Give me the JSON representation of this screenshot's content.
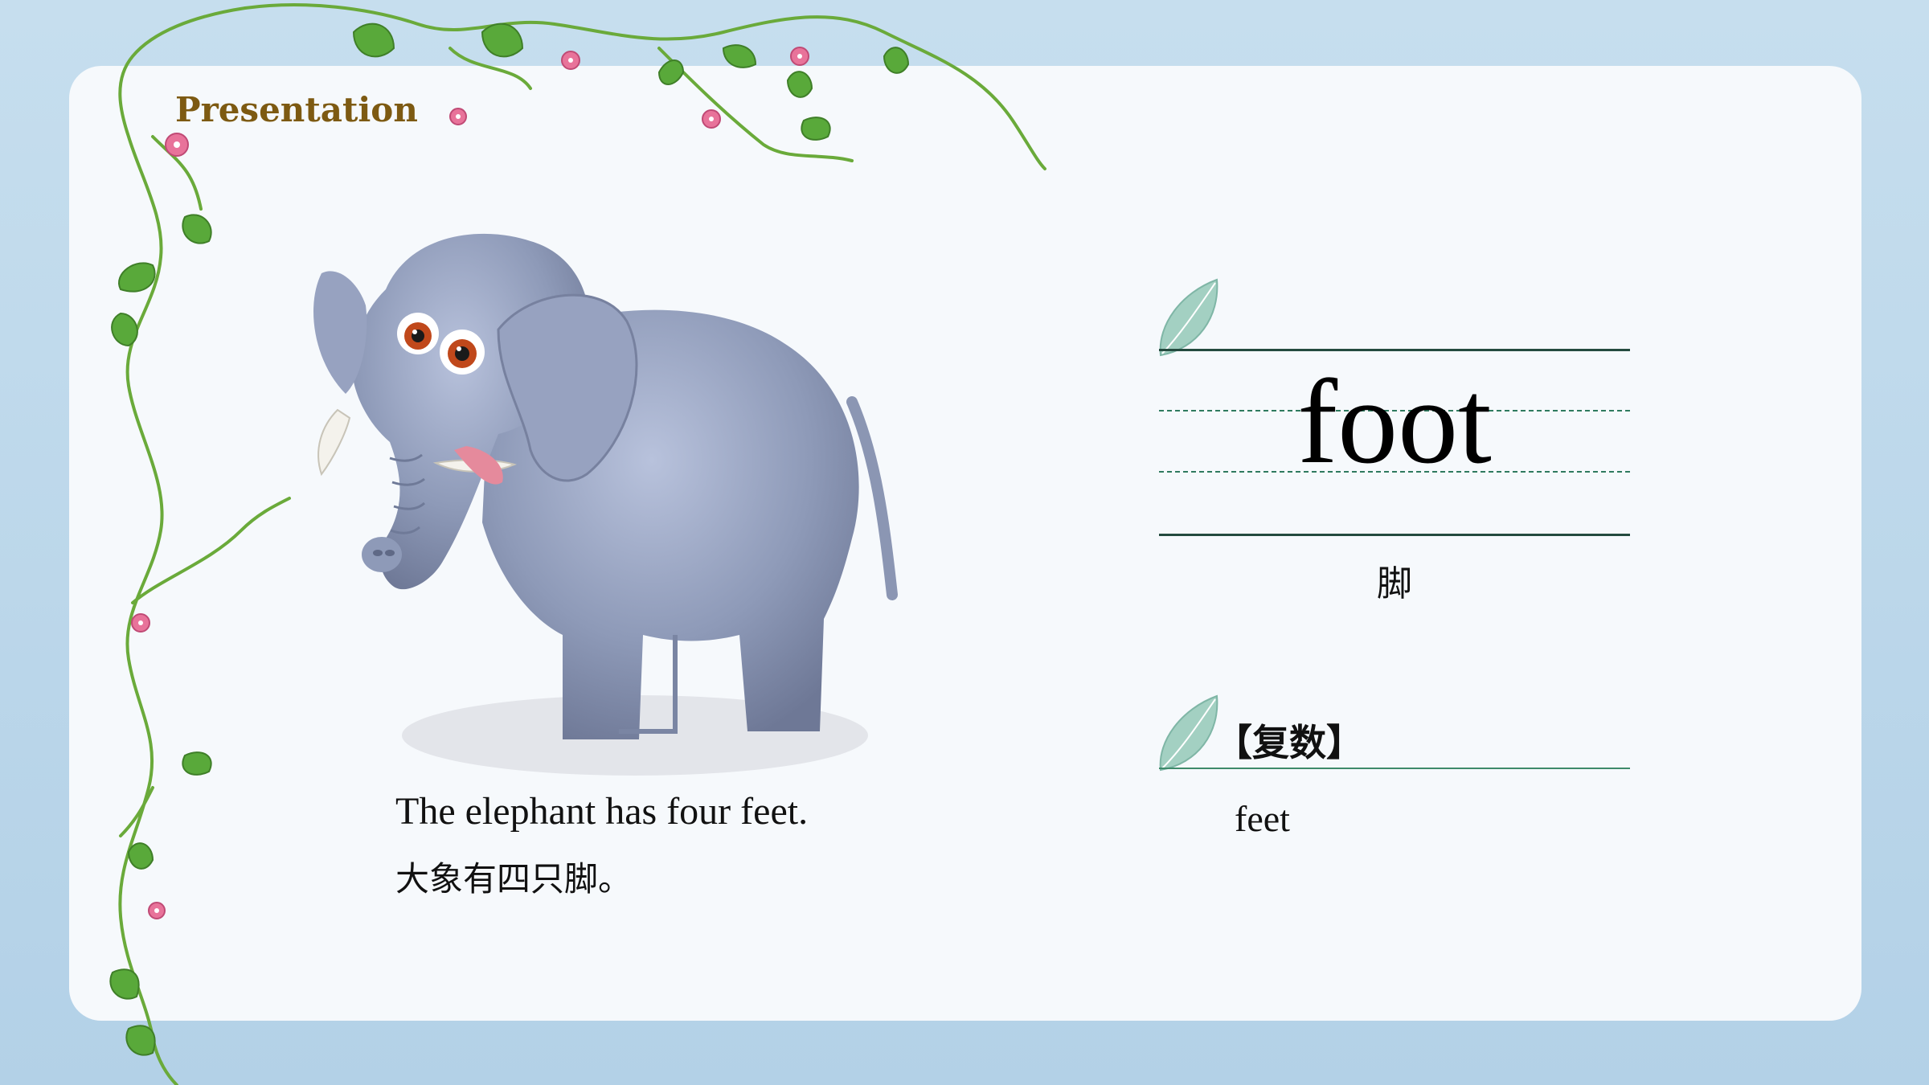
{
  "slide": {
    "heading": "Presentation",
    "example": {
      "sentence_en": "The elephant has four feet.",
      "sentence_zh": "大象有四只脚。"
    },
    "vocabulary": {
      "word": "foot",
      "meaning": "脚",
      "plural_label": "【复数】",
      "plural_value": "feet"
    }
  },
  "colors": {
    "background": "#bcd8eb",
    "card": "#f6f9fc",
    "heading": "#7d5a12",
    "leaf": "#9fcbbd",
    "rule": "#244b3f",
    "vine": "#6aaa3a",
    "flower": "#e8739a"
  },
  "images": {
    "elephant": "elephant-illustration",
    "vine": "flower-vine-decoration",
    "leaf": "leaf-icon"
  }
}
